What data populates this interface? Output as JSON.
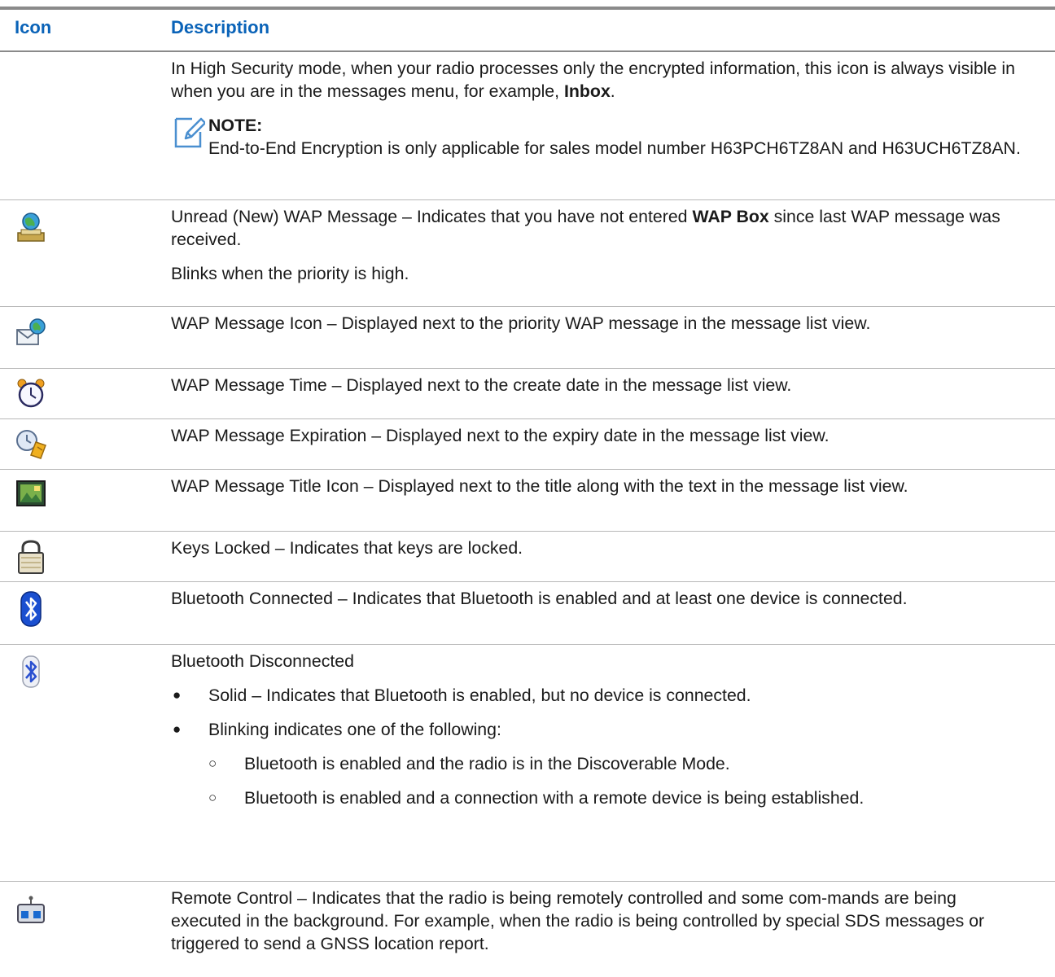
{
  "header": {
    "icon": "Icon",
    "description": "Description"
  },
  "rows": [
    {
      "icon": "none",
      "para1": "In High Security mode, when your radio processes only the encrypted information, this icon is always visible in when you are in the messages menu, for example,",
      "para1_bold": "Inbox",
      "para1_end": ".",
      "note_head": "NOTE:",
      "note_text": "End-to-End Encryption is only applicable for sales model number H63PCH6TZ8AN and H63UCH6TZ8AN."
    },
    {
      "icon": "wap-inbox-icon",
      "p1a": "Unread (New) WAP Message – Indicates that you have not entered",
      "p1b": "WAP Box",
      "p1c": "since last WAP message was received.",
      "p2": "Blinks when the priority is high."
    },
    {
      "icon": "wap-message-icon",
      "text": "WAP Message Icon – Displayed next to the priority WAP message in the message list view."
    },
    {
      "icon": "alarm-clock-icon",
      "text": "WAP Message Time – Displayed next to the create date in the message list view."
    },
    {
      "icon": "clock-expiration-icon",
      "text": "WAP Message Expiration – Displayed next to the expiry date in the message list view."
    },
    {
      "icon": "title-image-icon",
      "text": "WAP Message Title Icon – Displayed next to the title along with the text in the message list view."
    },
    {
      "icon": "padlock-icon",
      "text": "Keys Locked – Indicates that keys are locked."
    },
    {
      "icon": "bluetooth-connected-icon",
      "text": "Bluetooth Connected – Indicates that Bluetooth is enabled and at least one device is connected."
    },
    {
      "icon": "bluetooth-disconnected-icon",
      "title": "Bluetooth Disconnected",
      "bullets": [
        "Solid – Indicates that Bluetooth is enabled, but no device is connected.",
        "Blinking indicates one of the following:"
      ],
      "sub_bullets": [
        "Bluetooth is enabled and the radio is in the Discoverable Mode.",
        "Bluetooth is enabled and a connection with a remote device is being established."
      ],
      "bullet_glyph": "●",
      "sub_glyph": "○"
    },
    {
      "icon": "remote-control-icon",
      "text": "Remote Control – Indicates that the radio is being remotely controlled and some com-mands are being executed in the background. For example, when the radio is being controlled by special SDS messages or triggered to send a GNSS location report."
    }
  ]
}
